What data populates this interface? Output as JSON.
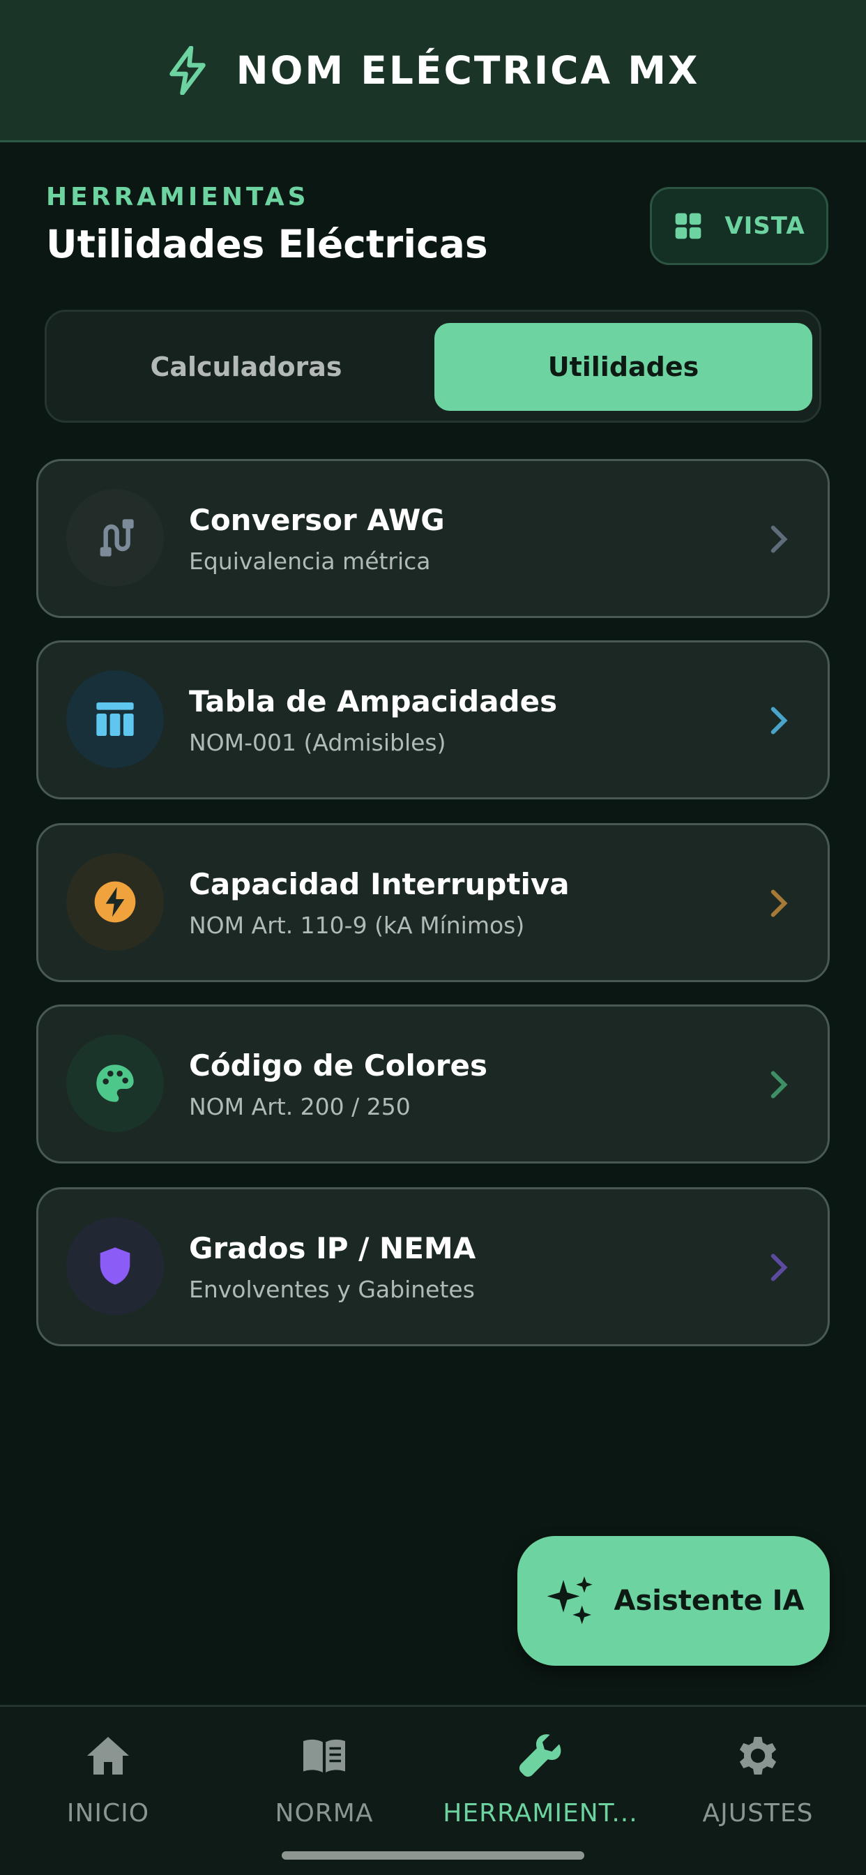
{
  "appbar": {
    "title": "NOM ELÉCTRICA MX",
    "icon": "bolt-icon"
  },
  "section": {
    "overline": "HERRAMIENTAS",
    "title": "Utilidades Eléctricas"
  },
  "view_button": {
    "label": "VISTA",
    "icon": "grid-icon"
  },
  "segment": {
    "options": [
      "Calculadoras",
      "Utilidades"
    ],
    "selected": "Utilidades"
  },
  "tools": [
    {
      "title": "Conversor AWG",
      "subtitle": "Equivalencia métrica",
      "icon": "cable-icon",
      "accent": "#7d8a9a"
    },
    {
      "title": "Tabla de Ampacidades",
      "subtitle": "NOM-001 (Admisibles)",
      "icon": "table-icon",
      "accent": "#5fc6f0"
    },
    {
      "title": "Capacidad Interruptiva",
      "subtitle": "NOM Art. 110-9 (kA Mínimos)",
      "icon": "bolt-circle-icon",
      "accent": "#f0a23c"
    },
    {
      "title": "Código de Colores",
      "subtitle": "NOM Art. 200 / 250",
      "icon": "palette-icon",
      "accent": "#4ec78a"
    },
    {
      "title": "Grados IP / NEMA",
      "subtitle": "Envolventes y Gabinetes",
      "icon": "shield-icon",
      "accent": "#8b5cf6"
    }
  ],
  "fab": {
    "label": "Asistente IA",
    "icon": "sparkles-icon"
  },
  "nav": [
    {
      "label": "INICIO",
      "icon": "home-icon"
    },
    {
      "label": "NORMA",
      "icon": "book-icon"
    },
    {
      "label": "HERRAMIENT...",
      "icon": "wrench-icon",
      "active": true
    },
    {
      "label": "AJUSTES",
      "icon": "gear-icon"
    }
  ],
  "colors": {
    "accent": "#6dd3a0",
    "background": "#0b1712",
    "card": "#1b2823"
  }
}
